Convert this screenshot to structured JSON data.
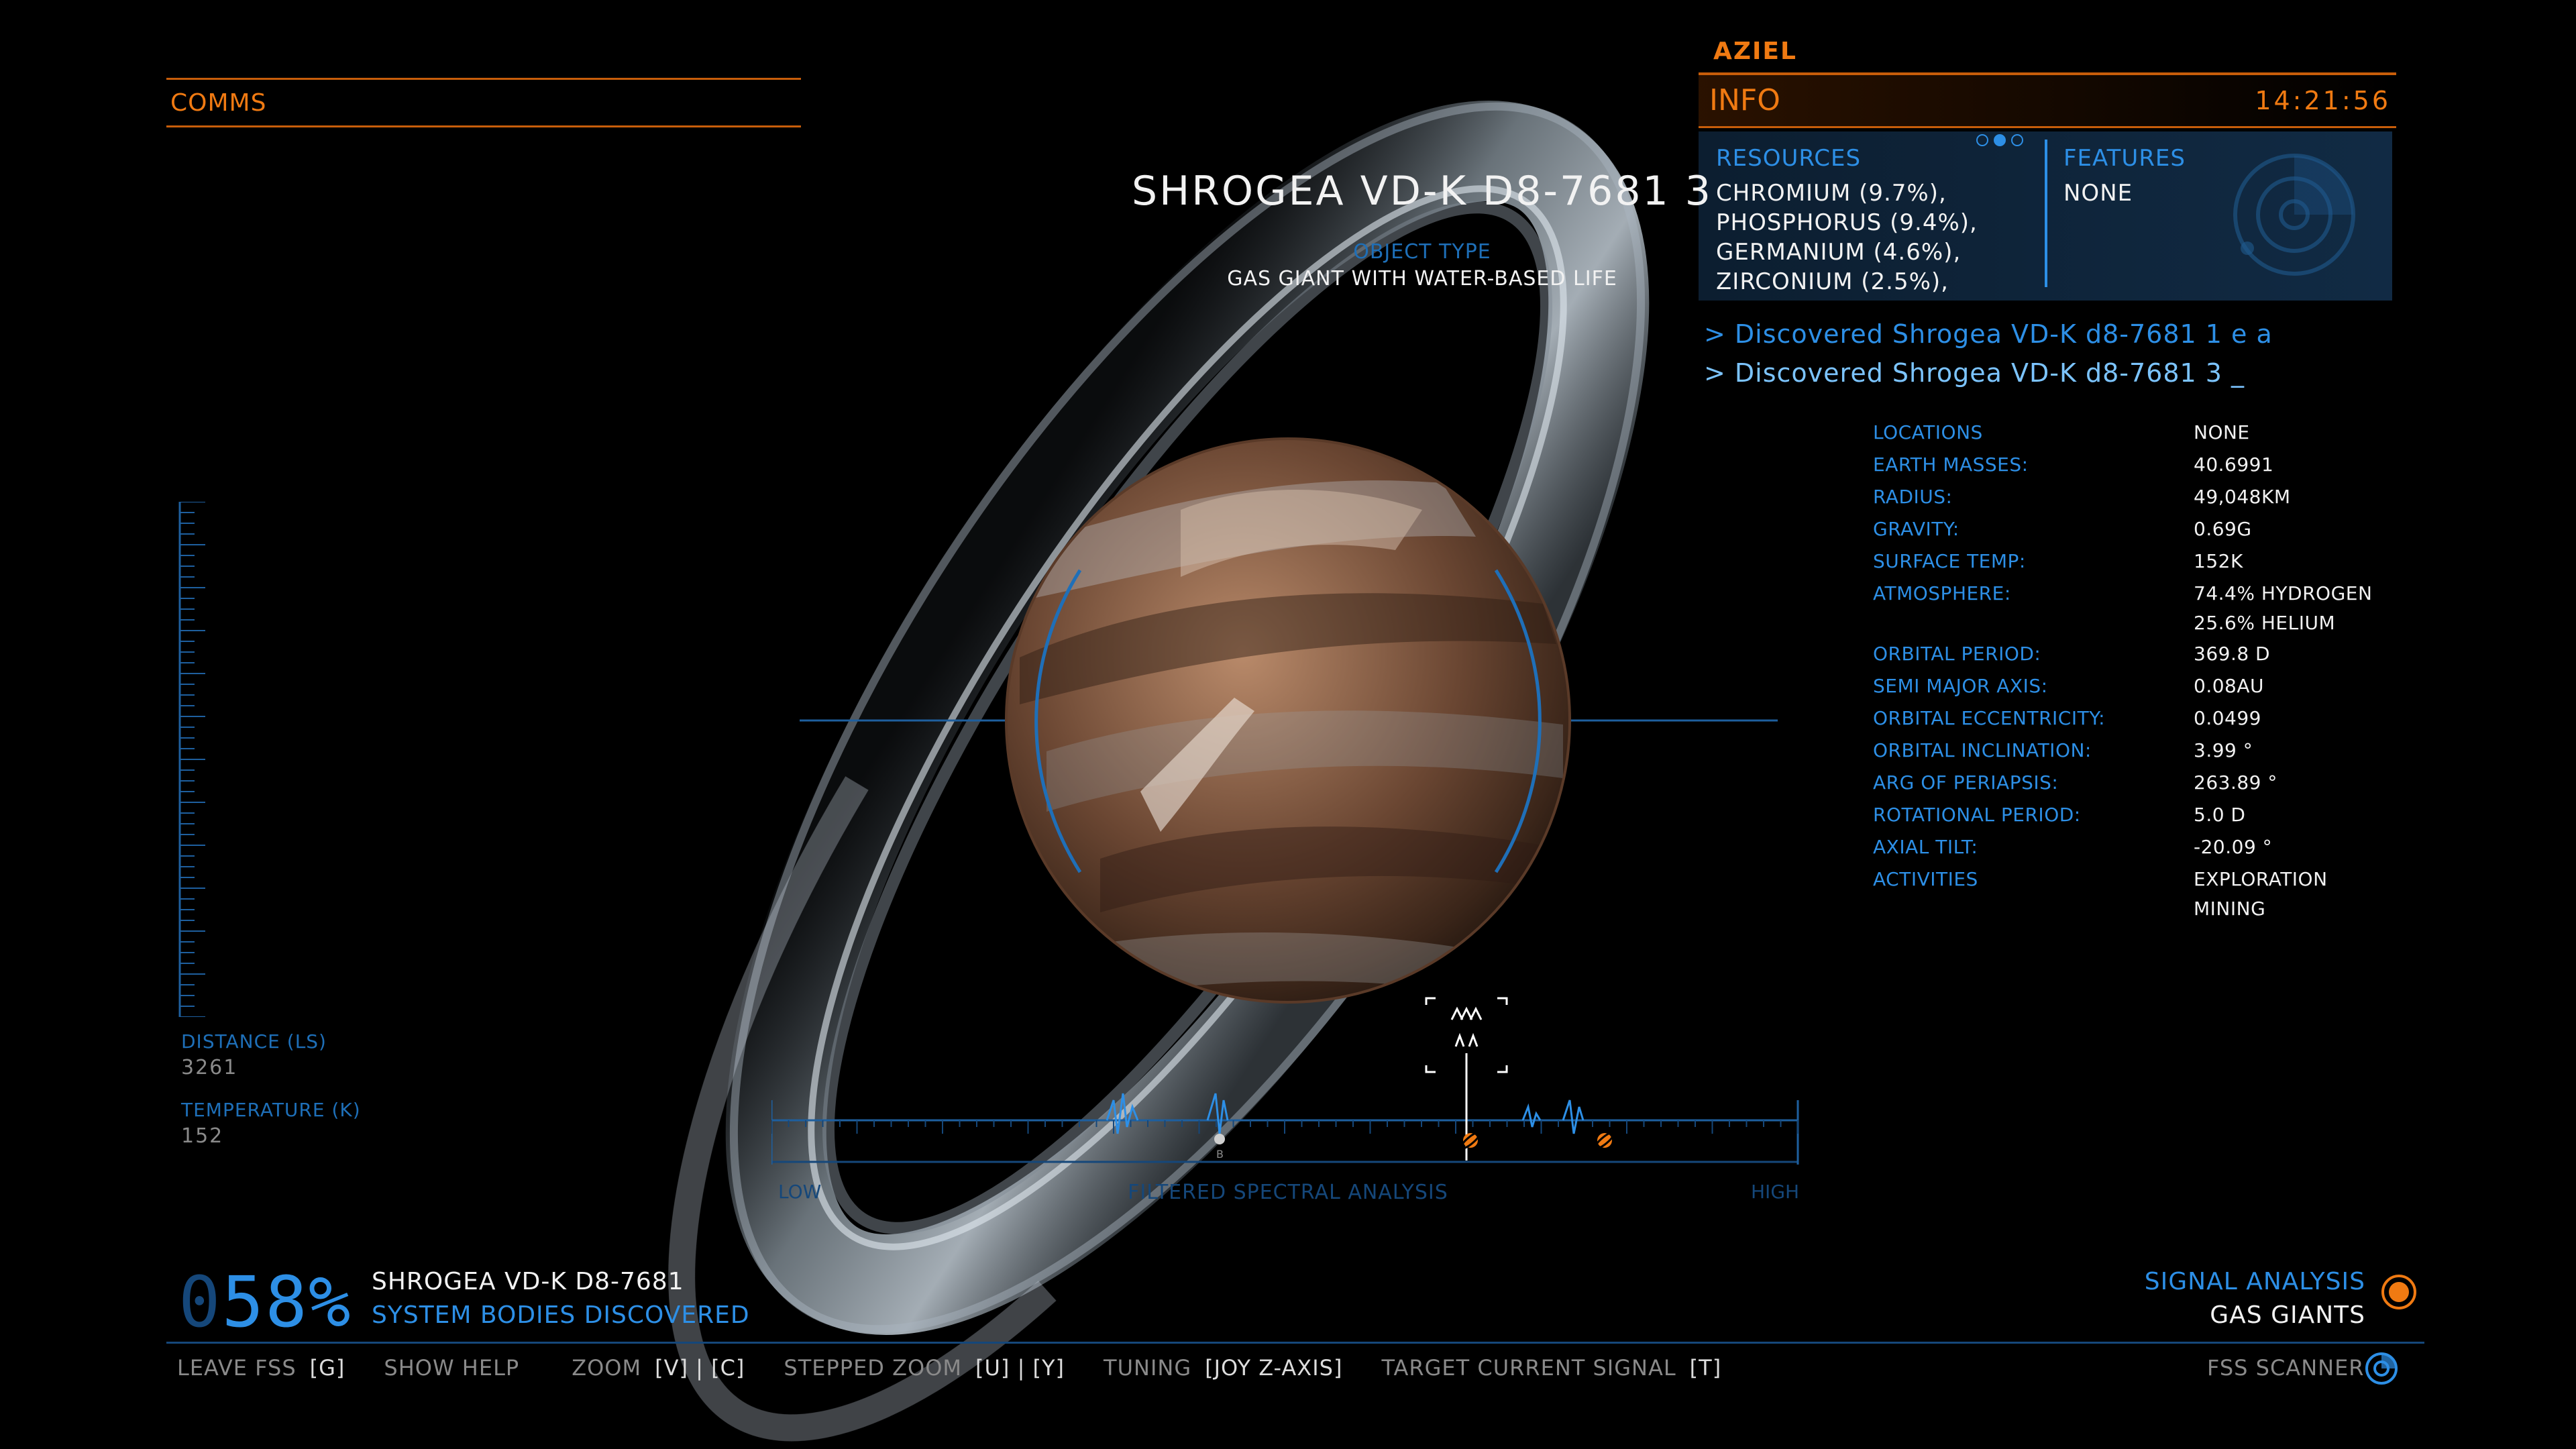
{
  "comms": {
    "label": "COMMS"
  },
  "commander": "AZIEL",
  "info": {
    "title": "INFO",
    "clock": "14:21:56",
    "resources_title": "RESOURCES",
    "resources": [
      "CHROMIUM (9.7%),",
      "PHOSPHORUS (9.4%),",
      "GERMANIUM (4.6%),",
      "ZIRCONIUM (2.5%),"
    ],
    "features_title": "FEATURES",
    "features_value": "NONE",
    "page_dots": 3,
    "active_dot": 1
  },
  "log": [
    "> Discovered Shrogea VD-K d8-7681 1 e a",
    "> Discovered Shrogea VD-K d8-7681 3  _"
  ],
  "stats": [
    {
      "label": "LOCATIONS",
      "value": "NONE"
    },
    {
      "label": "EARTH MASSES:",
      "value": "40.6991"
    },
    {
      "label": "RADIUS:",
      "value": "49,048KM"
    },
    {
      "label": "GRAVITY:",
      "value": "0.69G"
    },
    {
      "label": "SURFACE TEMP:",
      "value": "152K"
    },
    {
      "label": "ATMOSPHERE:",
      "value": "74.4% HYDROGEN"
    },
    {
      "label": "",
      "value": "25.6% HELIUM"
    },
    {
      "label": "ORBITAL PERIOD:",
      "value": "369.8 D"
    },
    {
      "label": "SEMI MAJOR AXIS:",
      "value": "0.08AU"
    },
    {
      "label": "ORBITAL ECCENTRICITY:",
      "value": "0.0499"
    },
    {
      "label": "ORBITAL INCLINATION:",
      "value": "3.99 °"
    },
    {
      "label": "ARG OF PERIAPSIS:",
      "value": "263.89 °"
    },
    {
      "label": "ROTATIONAL PERIOD:",
      "value": "5.0 D"
    },
    {
      "label": "AXIAL TILT:",
      "value": "-20.09 °"
    },
    {
      "label": "ACTIVITIES",
      "value": "EXPLORATION"
    },
    {
      "label": "",
      "value": "MINING"
    }
  ],
  "body": {
    "name": "SHROGEA VD-K D8-7681 3",
    "object_type_label": "OBJECT TYPE",
    "object_type": "GAS GIANT WITH WATER-BASED LIFE"
  },
  "left_readouts": {
    "distance_label": "DISTANCE (LS)",
    "distance_value": "3261",
    "temperature_label": "TEMPERATURE (K)",
    "temperature_value": "152"
  },
  "spectrum": {
    "low": "LOW",
    "title": "FILTERED SPECTRAL ANALYSIS",
    "high": "HIGH"
  },
  "progress": {
    "prefix": "0",
    "percent_text": "58%",
    "percent": 58,
    "system": "SHROGEA VD-K D8-7681",
    "caption": "SYSTEM BODIES DISCOVERED"
  },
  "signal": {
    "title": "SIGNAL ANALYSIS",
    "value": "GAS GIANTS"
  },
  "controls": [
    {
      "key": "LEAVE FSS",
      "bind": "[G]"
    },
    {
      "key": "SHOW HELP",
      "bind": ""
    },
    {
      "key": "ZOOM",
      "bind": "[V] | [C]"
    },
    {
      "key": "STEPPED ZOOM",
      "bind": "[U] | [Y]"
    },
    {
      "key": "TUNING",
      "bind": "[JOY Z-AXIS]"
    },
    {
      "key": "TARGET CURRENT SIGNAL",
      "bind": "[T]"
    }
  ],
  "fss_label": "FSS SCANNER",
  "colors": {
    "accent_orange": "#f07a12",
    "accent_blue": "#2d8fe6"
  }
}
